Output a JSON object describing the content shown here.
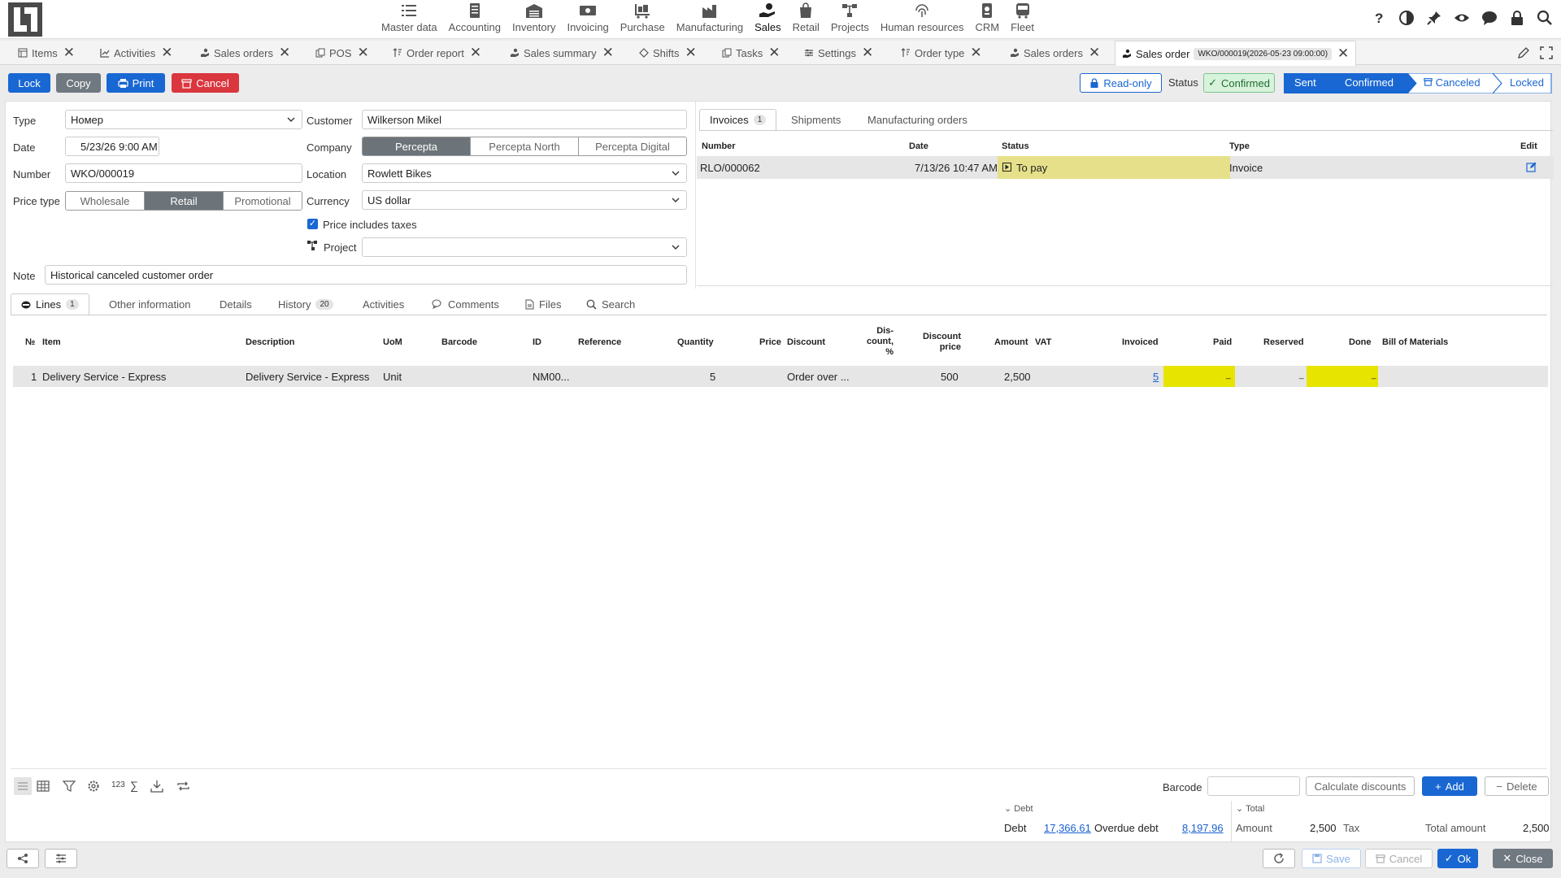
{
  "modules": [
    {
      "label": "Master data",
      "icon": "list-icon"
    },
    {
      "label": "Accounting",
      "icon": "ledger-icon"
    },
    {
      "label": "Inventory",
      "icon": "warehouse-icon"
    },
    {
      "label": "Invoicing",
      "icon": "cash-icon"
    },
    {
      "label": "Purchase",
      "icon": "trolley-icon"
    },
    {
      "label": "Manufacturing",
      "icon": "factory-icon"
    },
    {
      "label": "Sales",
      "icon": "hand-coin-icon"
    },
    {
      "label": "Retail",
      "icon": "shopping-bag-icon"
    },
    {
      "label": "Projects",
      "icon": "hierarchy-icon"
    },
    {
      "label": "Human resources",
      "icon": "fingerprint-icon"
    },
    {
      "label": "CRM",
      "icon": "badge-icon"
    },
    {
      "label": "Fleet",
      "icon": "bus-icon"
    }
  ],
  "doc_tabs": [
    "Items",
    "Activities",
    "Sales orders",
    "POS",
    "Order report",
    "Sales summary",
    "Shifts",
    "Tasks",
    "Settings",
    "Order type",
    "Sales orders"
  ],
  "active_tab": {
    "label": "Sales order",
    "id": "WKO/000019(2026-05-23 09:00:00)"
  },
  "toolbar": {
    "lock": "Lock",
    "copy": "Copy",
    "print": "Print",
    "cancel": "Cancel",
    "readonly": "Read-only",
    "status_label": "Status",
    "status": "Confirmed"
  },
  "workflow": [
    "Sent",
    "Confirmed",
    "Canceled",
    "Locked"
  ],
  "form": {
    "type_label": "Type",
    "type_value": "Номер",
    "date_label": "Date",
    "date_value": "5/23/26 9:00 AM",
    "number_label": "Number",
    "number_value": "WKO/000019",
    "price_type_label": "Price type",
    "price_types": [
      "Wholesale",
      "Retail",
      "Promotional"
    ],
    "customer_label": "Customer",
    "customer_value": "Wilkerson Mikel",
    "company_label": "Company",
    "companies": [
      "Percepta",
      "Percepta North",
      "Percepta Digital"
    ],
    "location_label": "Location",
    "location_value": "Rowlett Bikes",
    "currency_label": "Currency",
    "currency_value": "US dollar",
    "taxes_label": "Price includes taxes",
    "project_label": "Project",
    "note_label": "Note",
    "note_value": "Historical canceled customer order"
  },
  "right_tabs": {
    "invoices": "Invoices",
    "invoices_count": "1",
    "shipments": "Shipments",
    "mfg": "Manufacturing orders"
  },
  "invoices": {
    "headers": {
      "number": "Number",
      "date": "Date",
      "status": "Status",
      "type": "Type",
      "edit": "Edit"
    },
    "rows": [
      {
        "number": "RLO/000062",
        "date": "7/13/26 10:47 AM",
        "status": "To pay",
        "type": "Invoice"
      }
    ]
  },
  "lower_tabs": {
    "lines": "Lines",
    "lines_count": "1",
    "other": "Other information",
    "details": "Details",
    "history": "History",
    "history_count": "20",
    "activities": "Activities",
    "comments": "Comments",
    "files": "Files",
    "search": "Search"
  },
  "lines": {
    "headers": {
      "no": "№",
      "item": "Item",
      "description": "Description",
      "uom": "UoM",
      "barcode": "Barcode",
      "id": "ID",
      "reference": "Reference",
      "quantity": "Quantity",
      "price": "Price",
      "discount": "Discount",
      "discount_pct_1": "Dis-",
      "discount_pct_2": "count,",
      "discount_pct_3": "%",
      "discount_price_1": "Discount",
      "discount_price_2": "price",
      "amount": "Amount",
      "vat": "VAT",
      "invoiced": "Invoiced",
      "paid": "Paid",
      "reserved": "Reserved",
      "done": "Done",
      "bom": "Bill of Materials"
    },
    "rows": [
      {
        "no": "1",
        "item": "Delivery Service - Express",
        "description": "Delivery Service - Express",
        "uom": "Unit",
        "id": "NM00...",
        "quantity": "5",
        "discount": "Order over ...",
        "discount_price": "500",
        "amount": "2,500",
        "invoiced": "5",
        "paid": "_",
        "reserved": "_",
        "done": "_"
      }
    ]
  },
  "bottom": {
    "n123": "123",
    "sigma": "∑",
    "barcode_label": "Barcode",
    "calc": "Calculate discounts",
    "add": "Add",
    "delete": "Delete"
  },
  "totals": {
    "debt_header": "Debt",
    "debt_label": "Debt",
    "debt_value": "17,366.61",
    "overdue_label": "Overdue debt",
    "overdue_value": "8,197.96",
    "total_header": "Total",
    "amount_label": "Amount",
    "amount_value": "2,500",
    "tax_label": "Tax",
    "total_label": "Total amount",
    "total_value": "2,500"
  },
  "footer": {
    "save": "Save",
    "cancel": "Cancel",
    "ok": "Ok",
    "close": "Close"
  },
  "colors": {
    "primary": "#1967d2",
    "danger": "#d9363e",
    "highlight_yellow": "#e7e400",
    "status_yellow": "#e6e08a",
    "confirmed_bg": "#d8f3dc"
  }
}
